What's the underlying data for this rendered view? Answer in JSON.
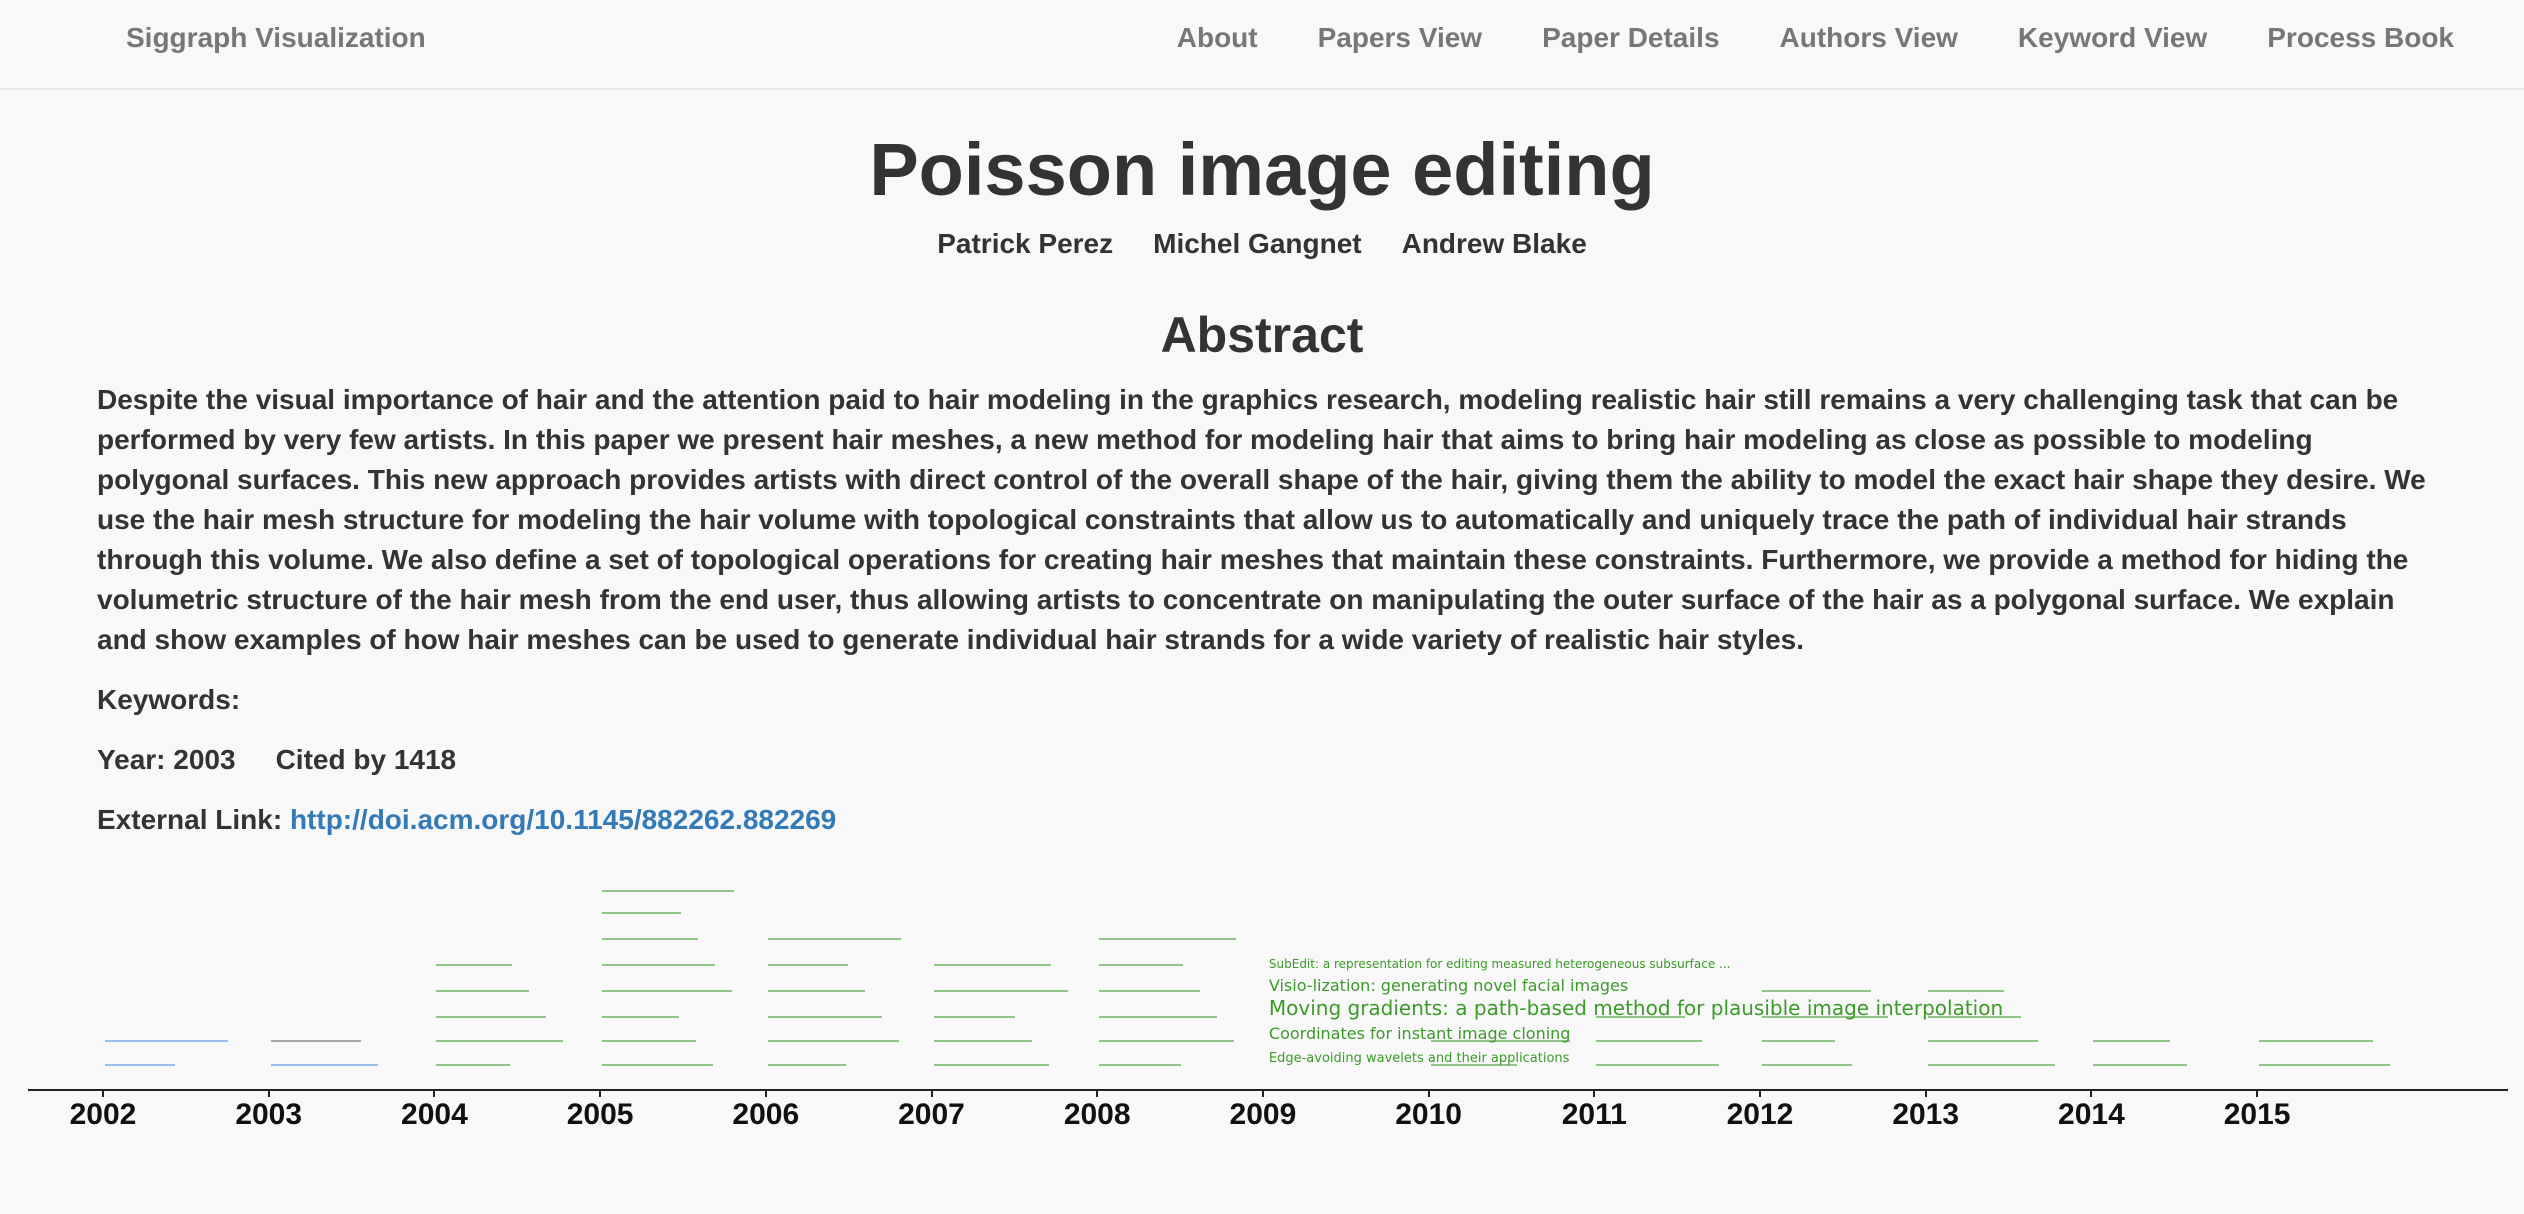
{
  "navbar": {
    "brand": "Siggraph Visualization",
    "items": [
      "About",
      "Papers View",
      "Paper Details",
      "Authors View",
      "Keyword View",
      "Process Book"
    ]
  },
  "paper": {
    "title": "Poisson image editing",
    "authors": [
      "Patrick Perez",
      "Michel Gangnet",
      "Andrew Blake"
    ],
    "abstract_heading": "Abstract",
    "abstract": "Despite the visual importance of hair and the attention paid to hair modeling in the graphics research, modeling realistic hair still remains a very challenging task that can be performed by very few artists. In this paper we present hair meshes, a new method for modeling hair that aims to bring hair modeling as close as possible to modeling polygonal surfaces. This new approach provides artists with direct control of the overall shape of the hair, giving them the ability to model the exact hair shape they desire. We use the hair mesh structure for modeling the hair volume with topological constraints that allow us to automatically and uniquely trace the path of individual hair strands through this volume. We also define a set of topological operations for creating hair meshes that maintain these constraints. Furthermore, we provide a method for hiding the volumetric structure of the hair mesh from the end user, thus allowing artists to concentrate on manipulating the outer surface of the hair as a polygonal surface. We explain and show examples of how hair meshes can be used to generate individual hair strands for a wide variety of realistic hair styles.",
    "keywords_label": "Keywords:",
    "year_label": "Year: 2003",
    "cited_label": "Cited by 1418",
    "external_label": "External Link:",
    "external_url": "http://doi.acm.org/10.1145/882262.882269"
  },
  "colors": {
    "brand_text": "#777777",
    "body_text": "#333333",
    "link": "#337ab7",
    "timeline_green": "#3c9a2a",
    "timeline_blue": "#4a90e2",
    "timeline_gray": "#666666"
  },
  "timeline": {
    "years": [
      "2002",
      "2003",
      "2004",
      "2005",
      "2006",
      "2007",
      "2008",
      "2009",
      "2010",
      "2011",
      "2012",
      "2013",
      "2014",
      "2015"
    ],
    "highlight_year": "2009",
    "highlight_entries": [
      "SubEdit: a representation for editing measured heterogeneous subsurface ...",
      "Visio-lization: generating novel facial images",
      "Moving gradients: a path-based method for plausible image interpolation",
      "Coordinates for instant image cloning",
      "Edge-avoiding wavelets and their applications"
    ]
  }
}
